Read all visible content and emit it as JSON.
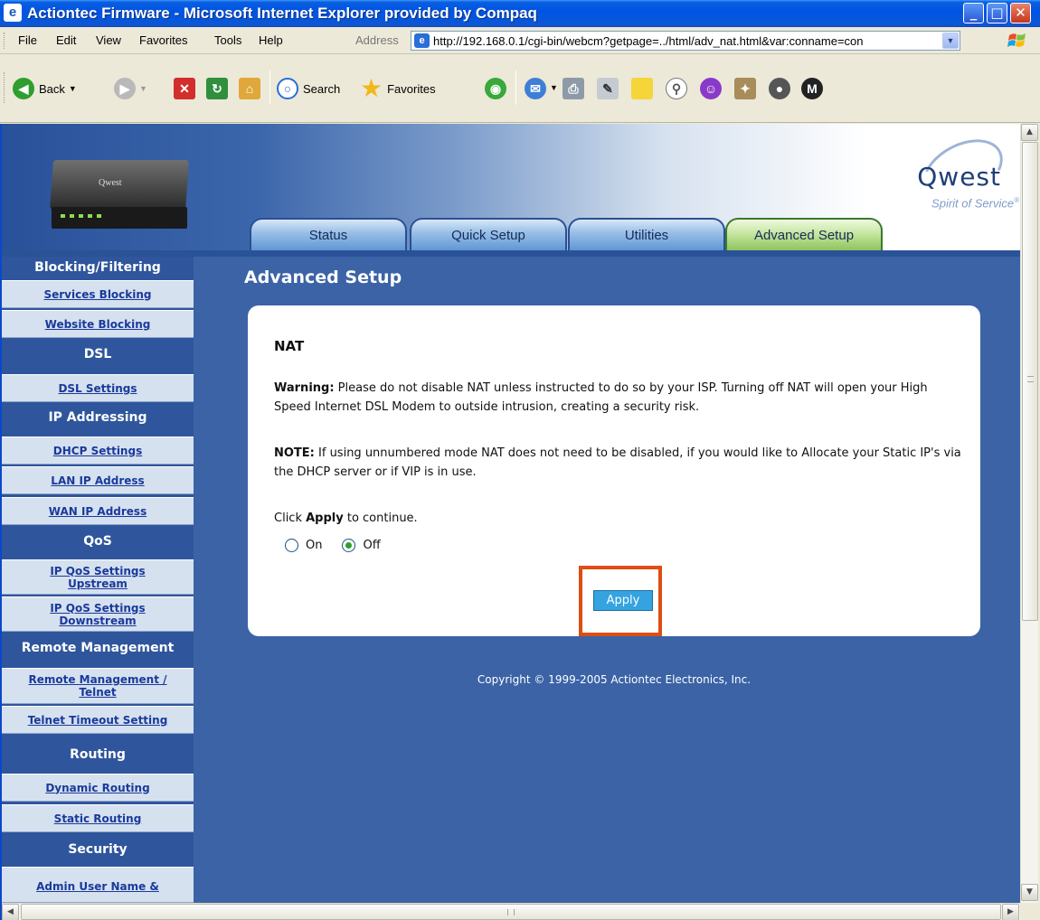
{
  "window": {
    "title": "Actiontec Firmware - Microsoft Internet Explorer provided by Compaq",
    "minimize": "_",
    "maximize": "□",
    "close": "✕"
  },
  "menu": {
    "items": [
      "File",
      "Edit",
      "View",
      "Favorites",
      "Tools",
      "Help"
    ],
    "address_label": "Address",
    "address_value": "http://192.168.0.1/cgi-bin/webcm?getpage=../html/adv_nat.html&var:conname=con"
  },
  "toolbar": {
    "back_label": "Back",
    "search_label": "Search",
    "favorites_label": "Favorites"
  },
  "header": {
    "brand_name": "Qwest",
    "brand_slogan": "Spirit of Service",
    "brand_trademark": "®",
    "modem_label": "Qwest"
  },
  "tabs": [
    {
      "label": "Status",
      "active": false
    },
    {
      "label": "Quick Setup",
      "active": false
    },
    {
      "label": "Utilities",
      "active": false
    },
    {
      "label": "Advanced Setup",
      "active": true
    }
  ],
  "sidebar": {
    "sections": [
      {
        "heading": "Blocking/Filtering",
        "items": [
          "Services Blocking",
          "Website Blocking"
        ]
      },
      {
        "heading": "DSL",
        "items": [
          "DSL Settings"
        ]
      },
      {
        "heading": "IP Addressing",
        "items": [
          "DHCP Settings",
          "LAN IP Address",
          "WAN IP Address"
        ]
      },
      {
        "heading": "QoS",
        "items": [
          "IP QoS Settings Upstream",
          "IP QoS Settings Downstream"
        ]
      },
      {
        "heading": "Remote Management",
        "items": [
          "Remote Management / Telnet",
          "Telnet Timeout Setting"
        ]
      },
      {
        "heading": "Routing",
        "items": [
          "Dynamic Routing",
          "Static Routing"
        ]
      },
      {
        "heading": "Security",
        "items": [
          "Admin User Name &"
        ]
      }
    ]
  },
  "main": {
    "page_title": "Advanced Setup",
    "section_title": "NAT",
    "warning_label": "Warning:",
    "warning_text": " Please do not disable NAT unless instructed to do so by your ISP. Turning off NAT will open your High Speed Internet DSL Modem to outside intrusion, creating a security risk.",
    "note_label": "NOTE:",
    "note_text": " If using unnumbered mode NAT does not need to be disabled, if you would like to Allocate your Static IP's via the DHCP server or if VIP is in use.",
    "click_prefix": "Click ",
    "click_bold": "Apply",
    "click_suffix": " to continue.",
    "radio_on": "On",
    "radio_off": "Off",
    "selected": "Off",
    "apply_label": "Apply",
    "highlight_color": "#dc4e12"
  },
  "footer": {
    "copyright": "Copyright © 1999-2005 Actiontec Electronics, Inc."
  }
}
